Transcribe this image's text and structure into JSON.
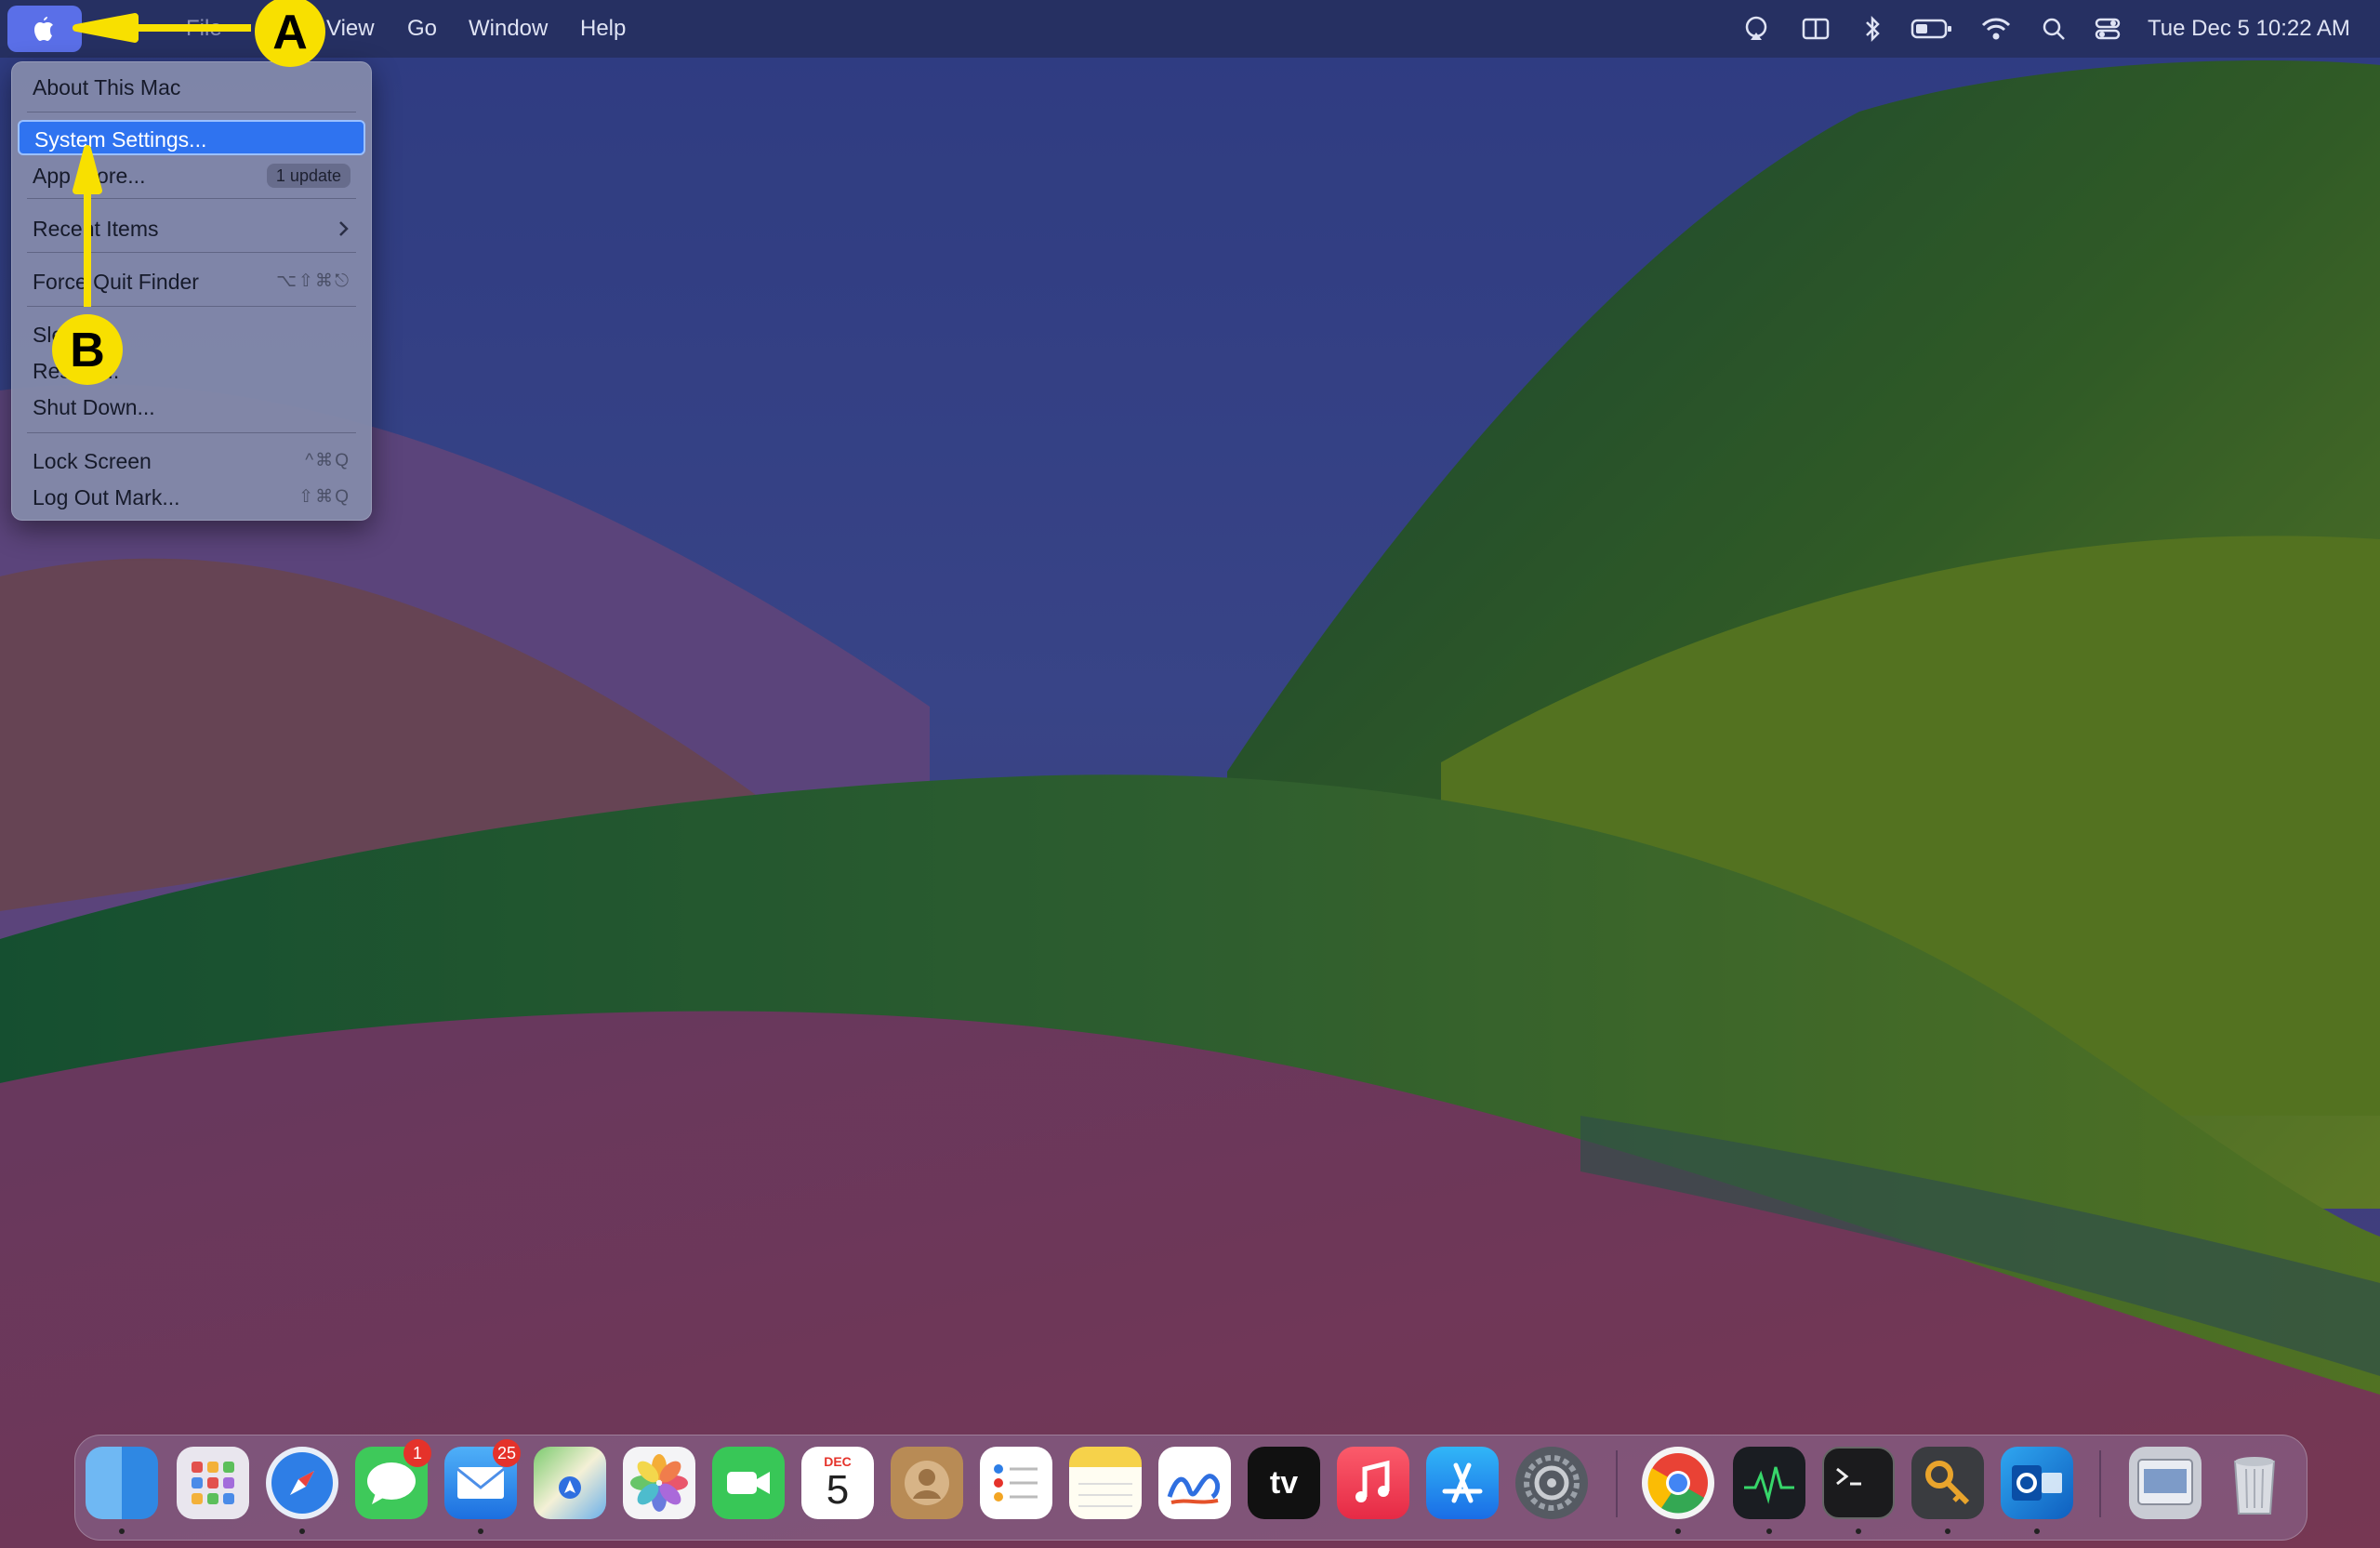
{
  "menubar": {
    "apple_icon": "apple-icon",
    "items": [
      "File",
      "View",
      "Go",
      "Window",
      "Help"
    ],
    "status_icons": [
      "airplay-icon",
      "split-view-icon",
      "bluetooth-icon",
      "battery-icon",
      "wifi-icon",
      "search-icon",
      "control-center-icon"
    ],
    "datetime": "Tue Dec 5  10:22 AM"
  },
  "apple_menu": {
    "items": [
      {
        "label": "About This Mac"
      },
      {
        "label": "System Settings...",
        "selected": true
      },
      {
        "label": "App Store...",
        "badge": "1 update"
      },
      {
        "label": "Recent Items",
        "submenu": true
      },
      {
        "label": "Force Quit Finder",
        "shortcut": "⌥⇧⌘⎋"
      },
      {
        "label": "Sleep"
      },
      {
        "label": "Restart..."
      },
      {
        "label": "Shut Down..."
      },
      {
        "label": "Lock Screen",
        "shortcut": "^⌘Q"
      },
      {
        "label": "Log Out Mark...",
        "shortcut": "⇧⌘Q"
      }
    ]
  },
  "annotations": {
    "a": "A",
    "b": "B"
  },
  "dock": {
    "apps": [
      {
        "name": "Finder",
        "icon": "finder-icon",
        "running": true
      },
      {
        "name": "Launchpad",
        "icon": "launchpad-icon"
      },
      {
        "name": "Safari",
        "icon": "safari-icon",
        "running": true
      },
      {
        "name": "Messages",
        "icon": "messages-icon",
        "badge": "1"
      },
      {
        "name": "Mail",
        "icon": "mail-icon",
        "badge": "25",
        "running": true
      },
      {
        "name": "Maps",
        "icon": "maps-icon"
      },
      {
        "name": "Photos",
        "icon": "photos-icon"
      },
      {
        "name": "FaceTime",
        "icon": "facetime-icon"
      },
      {
        "name": "Calendar",
        "icon": "calendar-icon",
        "month": "DEC",
        "day": "5"
      },
      {
        "name": "Contacts",
        "icon": "contacts-icon"
      },
      {
        "name": "Reminders",
        "icon": "reminders-icon"
      },
      {
        "name": "Notes",
        "icon": "notes-icon"
      },
      {
        "name": "Freeform",
        "icon": "freeform-icon"
      },
      {
        "name": "TV",
        "icon": "tv-icon",
        "label": "tv"
      },
      {
        "name": "Music",
        "icon": "music-icon"
      },
      {
        "name": "App Store",
        "icon": "app-store-icon"
      },
      {
        "name": "System Settings",
        "icon": "system-settings-icon"
      },
      {
        "name": "Chrome",
        "icon": "chrome-icon",
        "running": true
      },
      {
        "name": "Activity Monitor",
        "icon": "activity-monitor-icon",
        "running": true
      },
      {
        "name": "Terminal",
        "icon": "terminal-icon",
        "running": true
      },
      {
        "name": "Keychain Access",
        "icon": "keychain-icon",
        "running": true
      },
      {
        "name": "Outlook",
        "icon": "outlook-icon",
        "running": true
      },
      {
        "name": "Downloads",
        "icon": "downloads-stack-icon"
      },
      {
        "name": "Trash",
        "icon": "trash-icon"
      }
    ]
  },
  "colors": {
    "selection": "#2f73f0",
    "annotation": "#f8e000",
    "menubar": "#26305f"
  }
}
